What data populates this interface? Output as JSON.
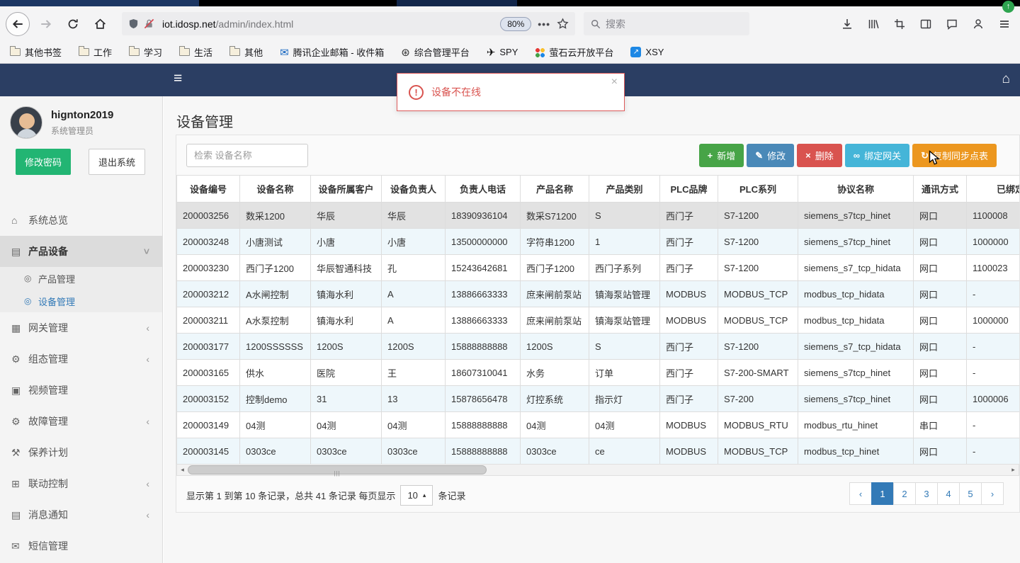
{
  "browser": {
    "url": {
      "host": "iot.idosp.net",
      "path": "/admin/index.html"
    },
    "zoom_badge": "80%",
    "search_placeholder": "搜索",
    "bookmarks": [
      {
        "label": "其他书签",
        "icon": "folder"
      },
      {
        "label": "工作",
        "icon": "folder"
      },
      {
        "label": "学习",
        "icon": "folder"
      },
      {
        "label": "生活",
        "icon": "folder"
      },
      {
        "label": "其他",
        "icon": "folder"
      },
      {
        "label": "腾讯企业邮箱 - 收件箱",
        "icon": "mail"
      },
      {
        "label": "综合管理平台",
        "icon": "globe"
      },
      {
        "label": "SPY",
        "icon": "plane"
      },
      {
        "label": "萤石云开放平台",
        "icon": "dots"
      },
      {
        "label": "XSY",
        "icon": "app"
      }
    ]
  },
  "alert": {
    "message": "设备不在线",
    "close": "×"
  },
  "colors": {
    "app_header": "#2b3e63",
    "active_link": "#337ab7",
    "alert_red": "#d9534f",
    "sidebar_button_green": "#22b573"
  },
  "sidebar": {
    "username": "hignton2019",
    "role": "系统管理员",
    "buttons": {
      "change_password": "修改密码",
      "logout": "退出系统"
    },
    "menu": [
      {
        "label": "系统总览",
        "icon": "home"
      },
      {
        "label": "产品设备",
        "icon": "book",
        "active": true,
        "expanded": true,
        "children": [
          {
            "label": "产品管理",
            "icon": "target"
          },
          {
            "label": "设备管理",
            "icon": "target",
            "active": true
          }
        ]
      },
      {
        "label": "网关管理",
        "icon": "grid",
        "collapsible": true
      },
      {
        "label": "组态管理",
        "icon": "gears",
        "collapsible": true
      },
      {
        "label": "视频管理",
        "icon": "monitor"
      },
      {
        "label": "故障管理",
        "icon": "gears",
        "collapsible": true
      },
      {
        "label": "保养计划",
        "icon": "wrench"
      },
      {
        "label": "联动控制",
        "icon": "sitemap",
        "collapsible": true
      },
      {
        "label": "消息通知",
        "icon": "book",
        "collapsible": true
      },
      {
        "label": "短信管理",
        "icon": "envelope"
      }
    ]
  },
  "main": {
    "title": "设备管理",
    "search_placeholder": "检索 设备名称",
    "toolbar_buttons": [
      {
        "name": "add-button",
        "label": "新增",
        "icon": "plus",
        "color": "#47a447"
      },
      {
        "name": "edit-button",
        "label": "修改",
        "icon": "pencil",
        "color": "#4a89b8"
      },
      {
        "name": "delete-button",
        "label": "删除",
        "icon": "cross",
        "color": "#d9534f"
      },
      {
        "name": "bind-gateway-button",
        "label": "绑定网关",
        "icon": "link",
        "color": "#45b5d8"
      },
      {
        "name": "copy-sync-table-button",
        "label": "复制同步点表",
        "icon": "sync",
        "color": "#ec971f"
      }
    ],
    "table": {
      "columns": [
        "设备编号",
        "设备名称",
        "设备所属客户",
        "设备负责人",
        "负责人电话",
        "产品名称",
        "产品类别",
        "PLC品牌",
        "PLC系列",
        "协议名称",
        "通讯方式",
        "已绑定网关"
      ],
      "rows": [
        {
          "selected": true,
          "cells": [
            "200003256",
            "数采1200",
            "华辰",
            "华辰",
            "18390936104",
            "数采S71200",
            "S",
            "西门子",
            "S7-1200",
            "siemens_s7tcp_hinet",
            "网口",
            "1100008"
          ]
        },
        {
          "cells": [
            "200003248",
            "小唐测试",
            "小唐",
            "小唐",
            "13500000000",
            "字符串1200",
            "1",
            "西门子",
            "S7-1200",
            "siemens_s7tcp_hinet",
            "网口",
            "1000000"
          ]
        },
        {
          "cells": [
            "200003230",
            "西门子1200",
            "华辰智通科技",
            "孔",
            "15243642681",
            "西门子1200",
            "西门子系列",
            "西门子",
            "S7-1200",
            "siemens_s7_tcp_hidata",
            "网口",
            "1100023"
          ]
        },
        {
          "cells": [
            "200003212",
            "A水闸控制",
            "镇海水利",
            "A",
            "13886663333",
            "庶来闸前泵站",
            "镇海泵站管理",
            "MODBUS",
            "MODBUS_TCP",
            "modbus_tcp_hidata",
            "网口",
            "-"
          ]
        },
        {
          "cells": [
            "200003211",
            "A水泵控制",
            "镇海水利",
            "A",
            "13886663333",
            "庶来闸前泵站",
            "镇海泵站管理",
            "MODBUS",
            "MODBUS_TCP",
            "modbus_tcp_hidata",
            "网口",
            "1000000"
          ]
        },
        {
          "cells": [
            "200003177",
            "1200SSSSSS",
            "1200S",
            "1200S",
            "15888888888",
            "1200S",
            "S",
            "西门子",
            "S7-1200",
            "siemens_s7_tcp_hidata",
            "网口",
            "-"
          ]
        },
        {
          "cells": [
            "200003165",
            "供水",
            "医院",
            "王",
            "18607310041",
            "水务",
            "订单",
            "西门子",
            "S7-200-SMART",
            "siemens_s7tcp_hinet",
            "网口",
            "-"
          ]
        },
        {
          "cells": [
            "200003152",
            "控制demo",
            "31",
            "13",
            "15878656478",
            "灯控系统",
            "指示灯",
            "西门子",
            "S7-200",
            "siemens_s7tcp_hinet",
            "网口",
            "1000006"
          ]
        },
        {
          "cells": [
            "200003149",
            "04测",
            "04测",
            "04测",
            "15888888888",
            "04测",
            "04测",
            "MODBUS",
            "MODBUS_RTU",
            "modbus_rtu_hinet",
            "串口",
            "-"
          ]
        },
        {
          "cells": [
            "200003145",
            "0303ce",
            "0303ce",
            "0303ce",
            "15888888888",
            "0303ce",
            "ce",
            "MODBUS",
            "MODBUS_TCP",
            "modbus_tcp_hinet",
            "网口",
            "-"
          ]
        }
      ]
    },
    "pagination": {
      "info_prefix": "显示第 1 到第 10 条记录，总共 41 条记录 每页显示",
      "page_size": "10",
      "info_suffix": "条记录",
      "prev": "‹",
      "next": "›",
      "pages": [
        "1",
        "2",
        "3",
        "4",
        "5"
      ],
      "active_page": "1"
    }
  }
}
